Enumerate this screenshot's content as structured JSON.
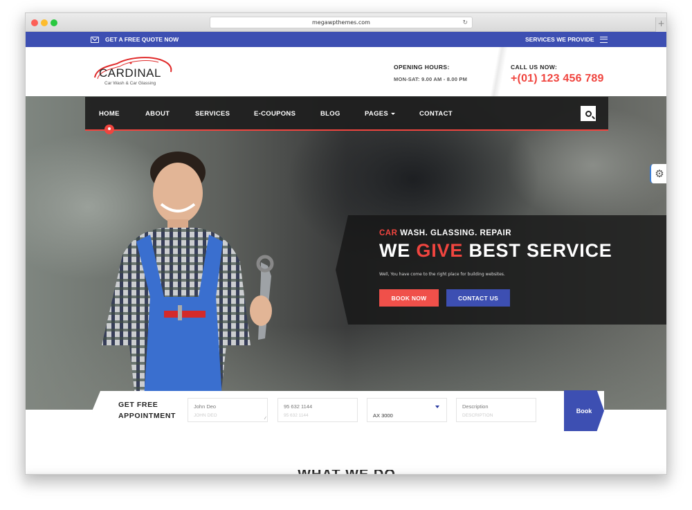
{
  "browser": {
    "url": "megawpthemes.com"
  },
  "topbar": {
    "quote_label": "GET A FREE QUOTE NOW",
    "services_label": "SERVICES WE PROVIDE"
  },
  "header": {
    "logo_name": "CARDINAL",
    "logo_tagline": "Car Wash & Car Glassing",
    "hours_title": "OPENING HOURS:",
    "hours_value": "MON-SAT: 9.00 AM - 8.00 PM",
    "call_title": "CALL US NOW:",
    "call_value": "+(01) 123 456 789"
  },
  "nav": {
    "items": [
      {
        "label": "HOME",
        "active": true
      },
      {
        "label": "ABOUT"
      },
      {
        "label": "SERVICES"
      },
      {
        "label": "E-COUPONS"
      },
      {
        "label": "BLOG"
      },
      {
        "label": "PAGES",
        "dropdown": true
      },
      {
        "label": "CONTACT"
      }
    ]
  },
  "hero": {
    "sub_red": "CAR",
    "sub_rest": " WASH. GLASSING. REPAIR",
    "head_1": "WE ",
    "head_red": "GIVE",
    "head_2": " BEST SERVICE",
    "description": "Well, You have come to the right place for building websites.",
    "book_label": "BOOK NOW",
    "contact_label": "CONTACT US"
  },
  "appointment": {
    "label_1": "GET FREE",
    "label_2": "APPOINTMENT",
    "name_value": "John Deo",
    "name_placeholder": "JOHN DEO",
    "phone_value": "95 632 1144",
    "phone_placeholder": "95 632 1144",
    "model_selected": "AX 3000",
    "desc_value": "Description",
    "desc_placeholder": "DESCRIPTION",
    "book_label": "Book"
  },
  "section": {
    "what_we_do": "WHAT WE DO"
  },
  "colors": {
    "accent_red": "#f0453f",
    "brand_blue": "#3d4fb2"
  }
}
